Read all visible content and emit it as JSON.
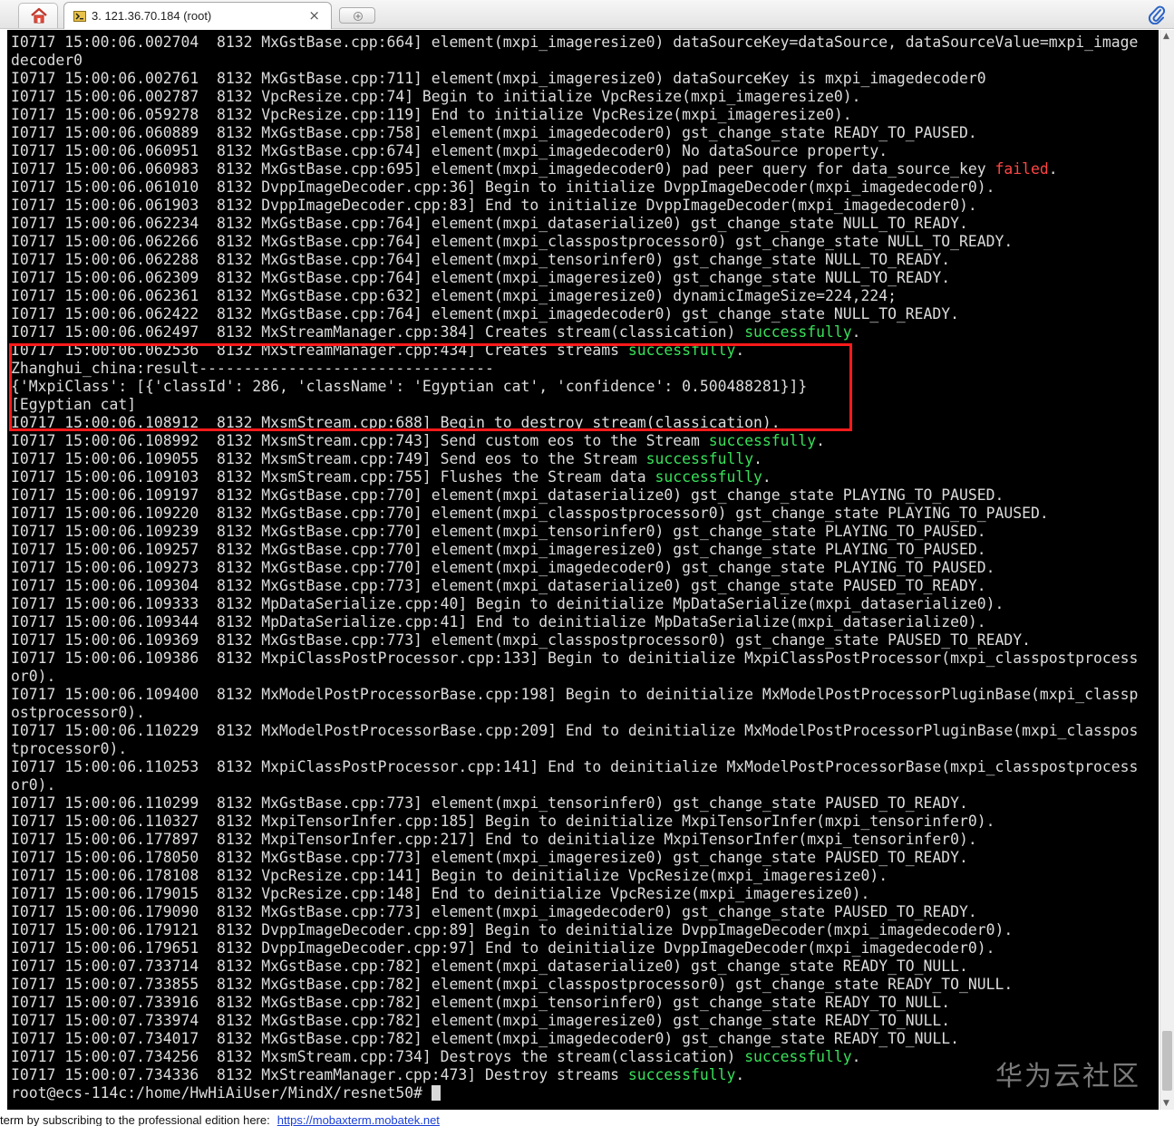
{
  "tabs": {
    "home_label": "",
    "active_title": "3. 121.36.70.184 (root)",
    "close_symbol": "×"
  },
  "terminal": {
    "lines": [
      [
        {
          "t": "I0717 15:00:06.002704  8132 MxGstBase.cpp:664] element(mxpi_imageresize0) dataSourceKey=dataSource, dataSourceValue=mxpi_image"
        }
      ],
      [
        {
          "t": "decoder0"
        }
      ],
      [
        {
          "t": "I0717 15:00:06.002761  8132 MxGstBase.cpp:711] element(mxpi_imageresize0) dataSourceKey is mxpi_imagedecoder0"
        }
      ],
      [
        {
          "t": "I0717 15:00:06.002787  8132 VpcResize.cpp:74] Begin to initialize VpcResize(mxpi_imageresize0)."
        }
      ],
      [
        {
          "t": "I0717 15:00:06.059278  8132 VpcResize.cpp:119] End to initialize VpcResize(mxpi_imageresize0)."
        }
      ],
      [
        {
          "t": "I0717 15:00:06.060889  8132 MxGstBase.cpp:758] element(mxpi_imagedecoder0) gst_change_state READY_TO_PAUSED."
        }
      ],
      [
        {
          "t": "I0717 15:00:06.060951  8132 MxGstBase.cpp:674] element(mxpi_imagedecoder0) No dataSource property."
        }
      ],
      [
        {
          "t": "I0717 15:00:06.060983  8132 MxGstBase.cpp:695] element(mxpi_imagedecoder0) pad peer query for data_source_key "
        },
        {
          "t": "failed",
          "c": "fail"
        },
        {
          "t": "."
        }
      ],
      [
        {
          "t": "I0717 15:00:06.061010  8132 DvppImageDecoder.cpp:36] Begin to initialize DvppImageDecoder(mxpi_imagedecoder0)."
        }
      ],
      [
        {
          "t": "I0717 15:00:06.061903  8132 DvppImageDecoder.cpp:83] End to initialize DvppImageDecoder(mxpi_imagedecoder0)."
        }
      ],
      [
        {
          "t": "I0717 15:00:06.062234  8132 MxGstBase.cpp:764] element(mxpi_dataserialize0) gst_change_state NULL_TO_READY."
        }
      ],
      [
        {
          "t": "I0717 15:00:06.062266  8132 MxGstBase.cpp:764] element(mxpi_classpostprocessor0) gst_change_state NULL_TO_READY."
        }
      ],
      [
        {
          "t": "I0717 15:00:06.062288  8132 MxGstBase.cpp:764] element(mxpi_tensorinfer0) gst_change_state NULL_TO_READY."
        }
      ],
      [
        {
          "t": "I0717 15:00:06.062309  8132 MxGstBase.cpp:764] element(mxpi_imageresize0) gst_change_state NULL_TO_READY."
        }
      ],
      [
        {
          "t": "I0717 15:00:06.062361  8132 MxGstBase.cpp:632] element(mxpi_imageresize0) dynamicImageSize=224,224;"
        }
      ],
      [
        {
          "t": "I0717 15:00:06.062422  8132 MxGstBase.cpp:764] element(mxpi_imagedecoder0) gst_change_state NULL_TO_READY."
        }
      ],
      [
        {
          "t": "I0717 15:00:06.062497  8132 MxStreamManager.cpp:384] Creates stream(classication) "
        },
        {
          "t": "successfully",
          "c": "ok"
        },
        {
          "t": "."
        }
      ],
      [
        {
          "t": "I0717 15:00:06.062536  8132 MxStreamManager.cpp:434] Creates streams "
        },
        {
          "t": "successfully",
          "c": "ok"
        },
        {
          "t": "."
        }
      ],
      [
        {
          "t": "Zhanghui_china:result---------------------------------"
        }
      ],
      [
        {
          "t": "{'MxpiClass': [{'classId': 286, 'className': 'Egyptian cat', 'confidence': 0.500488281}]}"
        }
      ],
      [
        {
          "t": "[Egyptian cat]"
        }
      ],
      [
        {
          "t": "I0717 15:00:06.108912  8132 MxsmStream.cpp:688] Begin to destroy stream(classication)."
        }
      ],
      [
        {
          "t": "I0717 15:00:06.108992  8132 MxsmStream.cpp:743] Send custom eos to the Stream "
        },
        {
          "t": "successfully",
          "c": "ok"
        },
        {
          "t": "."
        }
      ],
      [
        {
          "t": "I0717 15:00:06.109055  8132 MxsmStream.cpp:749] Send eos to the Stream "
        },
        {
          "t": "successfully",
          "c": "ok"
        },
        {
          "t": "."
        }
      ],
      [
        {
          "t": "I0717 15:00:06.109103  8132 MxsmStream.cpp:755] Flushes the Stream data "
        },
        {
          "t": "successfully",
          "c": "ok"
        },
        {
          "t": "."
        }
      ],
      [
        {
          "t": "I0717 15:00:06.109197  8132 MxGstBase.cpp:770] element(mxpi_dataserialize0) gst_change_state PLAYING_TO_PAUSED."
        }
      ],
      [
        {
          "t": "I0717 15:00:06.109220  8132 MxGstBase.cpp:770] element(mxpi_classpostprocessor0) gst_change_state PLAYING_TO_PAUSED."
        }
      ],
      [
        {
          "t": "I0717 15:00:06.109239  8132 MxGstBase.cpp:770] element(mxpi_tensorinfer0) gst_change_state PLAYING_TO_PAUSED."
        }
      ],
      [
        {
          "t": "I0717 15:00:06.109257  8132 MxGstBase.cpp:770] element(mxpi_imageresize0) gst_change_state PLAYING_TO_PAUSED."
        }
      ],
      [
        {
          "t": "I0717 15:00:06.109273  8132 MxGstBase.cpp:770] element(mxpi_imagedecoder0) gst_change_state PLAYING_TO_PAUSED."
        }
      ],
      [
        {
          "t": "I0717 15:00:06.109304  8132 MxGstBase.cpp:773] element(mxpi_dataserialize0) gst_change_state PAUSED_TO_READY."
        }
      ],
      [
        {
          "t": "I0717 15:00:06.109333  8132 MpDataSerialize.cpp:40] Begin to deinitialize MpDataSerialize(mxpi_dataserialize0)."
        }
      ],
      [
        {
          "t": "I0717 15:00:06.109344  8132 MpDataSerialize.cpp:41] End to deinitialize MpDataSerialize(mxpi_dataserialize0)."
        }
      ],
      [
        {
          "t": "I0717 15:00:06.109369  8132 MxGstBase.cpp:773] element(mxpi_classpostprocessor0) gst_change_state PAUSED_TO_READY."
        }
      ],
      [
        {
          "t": "I0717 15:00:06.109386  8132 MxpiClassPostProcessor.cpp:133] Begin to deinitialize MxpiClassPostProcessor(mxpi_classpostprocess"
        }
      ],
      [
        {
          "t": "or0)."
        }
      ],
      [
        {
          "t": "I0717 15:00:06.109400  8132 MxModelPostProcessorBase.cpp:198] Begin to deinitialize MxModelPostProcessorPluginBase(mxpi_classp"
        }
      ],
      [
        {
          "t": "ostprocessor0)."
        }
      ],
      [
        {
          "t": "I0717 15:00:06.110229  8132 MxModelPostProcessorBase.cpp:209] End to deinitialize MxModelPostProcessorPluginBase(mxpi_classpos"
        }
      ],
      [
        {
          "t": "tprocessor0)."
        }
      ],
      [
        {
          "t": "I0717 15:00:06.110253  8132 MxpiClassPostProcessor.cpp:141] End to deinitialize MxModelPostProcessorBase(mxpi_classpostprocess"
        }
      ],
      [
        {
          "t": "or0)."
        }
      ],
      [
        {
          "t": "I0717 15:00:06.110299  8132 MxGstBase.cpp:773] element(mxpi_tensorinfer0) gst_change_state PAUSED_TO_READY."
        }
      ],
      [
        {
          "t": "I0717 15:00:06.110327  8132 MxpiTensorInfer.cpp:185] Begin to deinitialize MxpiTensorInfer(mxpi_tensorinfer0)."
        }
      ],
      [
        {
          "t": "I0717 15:00:06.177897  8132 MxpiTensorInfer.cpp:217] End to deinitialize MxpiTensorInfer(mxpi_tensorinfer0)."
        }
      ],
      [
        {
          "t": "I0717 15:00:06.178050  8132 MxGstBase.cpp:773] element(mxpi_imageresize0) gst_change_state PAUSED_TO_READY."
        }
      ],
      [
        {
          "t": "I0717 15:00:06.178108  8132 VpcResize.cpp:141] Begin to deinitialize VpcResize(mxpi_imageresize0)."
        }
      ],
      [
        {
          "t": "I0717 15:00:06.179015  8132 VpcResize.cpp:148] End to deinitialize VpcResize(mxpi_imageresize0)."
        }
      ],
      [
        {
          "t": "I0717 15:00:06.179090  8132 MxGstBase.cpp:773] element(mxpi_imagedecoder0) gst_change_state PAUSED_TO_READY."
        }
      ],
      [
        {
          "t": "I0717 15:00:06.179121  8132 DvppImageDecoder.cpp:89] Begin to deinitialize DvppImageDecoder(mxpi_imagedecoder0)."
        }
      ],
      [
        {
          "t": "I0717 15:00:06.179651  8132 DvppImageDecoder.cpp:97] End to deinitialize DvppImageDecoder(mxpi_imagedecoder0)."
        }
      ],
      [
        {
          "t": "I0717 15:00:07.733714  8132 MxGstBase.cpp:782] element(mxpi_dataserialize0) gst_change_state READY_TO_NULL."
        }
      ],
      [
        {
          "t": "I0717 15:00:07.733855  8132 MxGstBase.cpp:782] element(mxpi_classpostprocessor0) gst_change_state READY_TO_NULL."
        }
      ],
      [
        {
          "t": "I0717 15:00:07.733916  8132 MxGstBase.cpp:782] element(mxpi_tensorinfer0) gst_change_state READY_TO_NULL."
        }
      ],
      [
        {
          "t": "I0717 15:00:07.733974  8132 MxGstBase.cpp:782] element(mxpi_imageresize0) gst_change_state READY_TO_NULL."
        }
      ],
      [
        {
          "t": "I0717 15:00:07.734017  8132 MxGstBase.cpp:782] element(mxpi_imagedecoder0) gst_change_state READY_TO_NULL."
        }
      ],
      [
        {
          "t": "I0717 15:00:07.734256  8132 MxsmStream.cpp:734] Destroys the stream(classication) "
        },
        {
          "t": "successfully",
          "c": "ok"
        },
        {
          "t": "."
        }
      ],
      [
        {
          "t": "I0717 15:00:07.734336  8132 MxStreamManager.cpp:473] Destroy streams "
        },
        {
          "t": "successfully",
          "c": "ok"
        },
        {
          "t": "."
        }
      ]
    ],
    "prompt": "root@ecs-114c:/home/HwHiAiUser/MindX/resnet50# ",
    "watermark": "华为云社区"
  },
  "status": {
    "text": "term by subscribing to the professional edition here:",
    "link": "https://mobaxterm.mobatek.net"
  },
  "colors": {
    "success": "#39e05a",
    "failed": "#ff4545",
    "highlight_box": "#ff1a1a",
    "terminal_bg": "#000000",
    "terminal_fg": "#dcdcdc"
  },
  "icons": [
    "home-icon",
    "terminal-tab-icon",
    "close-icon",
    "new-tab-icon",
    "paperclip-icon",
    "scroll-up-arrow-icon",
    "scroll-down-arrow-icon"
  ]
}
